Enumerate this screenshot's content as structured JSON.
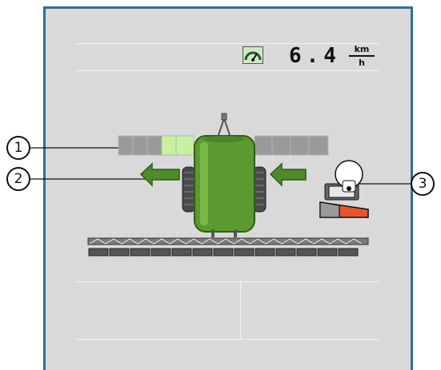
{
  "header": {
    "speed_value": "6.4",
    "speed_unit_numerator": "km",
    "speed_unit_denominator": "h",
    "speed_icon": "speedometer-icon"
  },
  "callouts": [
    {
      "label": "1"
    },
    {
      "label": "2"
    },
    {
      "label": "3"
    }
  ],
  "sprayer": {
    "left_sections": 4,
    "right_sections": 4,
    "active_left_section_index": 3,
    "boom_nozzle_count": 13,
    "tank_color": "#5a9a2e",
    "arrow_color": "#4f8a2b",
    "section_inactive_color": "#9a9a9a",
    "section_active_color": "#c6f2a0",
    "icons": [
      "left-arrow-icon",
      "right-arrow-icon",
      "tractor-sprayer-icon",
      "tilt-indicator-icon"
    ]
  },
  "colors": {
    "background": "#d9d9d9",
    "frame": "#2f6f95",
    "tilt_warning": "#e8542b"
  }
}
